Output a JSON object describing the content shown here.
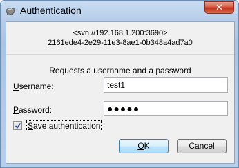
{
  "window": {
    "title": "Authentication",
    "close_symbol": "✕",
    "icon": "tortoisesvn-icon"
  },
  "header": {
    "repository_url": "<svn://192.168.1.200:3690>",
    "repository_uuid": "2161ede4-2e29-11e3-8ae1-0b348a4ad7a0"
  },
  "form": {
    "prompt": "Requests a username and a password",
    "username_label_underlined": "U",
    "username_label_rest": "sername:",
    "username_value": "test1",
    "password_label_underlined": "P",
    "password_label_rest": "assword:",
    "password_value": "●●●●●"
  },
  "footer": {
    "save_checked": true,
    "save_label_underlined": "S",
    "save_label_rest": "ave authentication",
    "ok_underlined": "O",
    "ok_rest": "K",
    "cancel_label": "Cancel"
  }
}
